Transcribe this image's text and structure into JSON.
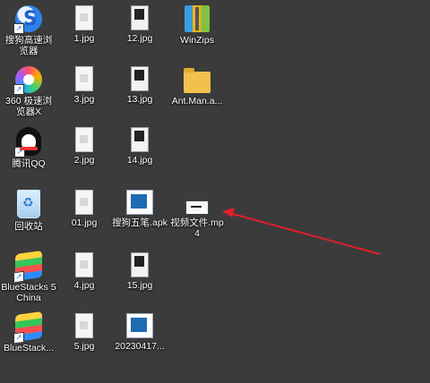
{
  "desktop": {
    "icons": {
      "sogou": "搜狗高速浏览器",
      "b360": "360 极速浏览器X",
      "qq": "腾讯QQ",
      "recycle": "回收站",
      "bluestacks5": "BlueStacks 5 China",
      "bluestackm": "BlueStack...",
      "jpg1": "1.jpg",
      "jpg3": "3.jpg",
      "jpg2": "2.jpg",
      "jpg01": "01.jpg",
      "jpg4": "4.jpg",
      "jpg5": "5.jpg",
      "jpg12": "12.jpg",
      "jpg13": "13.jpg",
      "jpg14": "14.jpg",
      "apk": "搜狗五笔.apk",
      "jpg15": "15.jpg",
      "file202304": "20230417...",
      "winzips": "WinZips",
      "antman": "Ant.Man.a...",
      "video": "视频文件.mp4"
    },
    "annotation_color": "#e0202a"
  }
}
